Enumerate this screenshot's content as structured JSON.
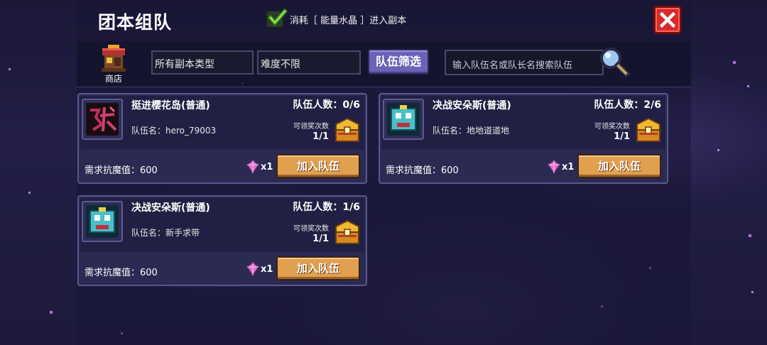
{
  "header": {
    "title": "团本组队",
    "consume_checked": true,
    "consume_label": "消耗［ 能量水晶 ］进入副本"
  },
  "toolbar": {
    "shop_label": "商店",
    "dungeon_type": "所有副本类型",
    "difficulty": "难度不限",
    "filter_label": "队伍筛选",
    "search_placeholder": "输入队伍名或队长名搜索队伍"
  },
  "cards": [
    {
      "dungeon": "挺进樱花岛(普通)",
      "members": "队伍人数：0/6",
      "team_name": "队伍名：hero_79003",
      "reward_label": "可领奖次数",
      "reward_count": "1/1",
      "magic": "需求抗魔值：600",
      "cost": "x1",
      "join": "加入队伍",
      "icon": "sakura-boss-icon"
    },
    {
      "dungeon": "决战安朵斯(普通)",
      "members": "队伍人数：2/6",
      "team_name": "队伍名：地地道道地",
      "reward_label": "可领奖次数",
      "reward_count": "1/1",
      "magic": "需求抗魔值：600",
      "cost": "x1",
      "join": "加入队伍",
      "icon": "andus-boss-icon"
    },
    {
      "dungeon": "决战安朵斯(普通)",
      "members": "队伍人数：1/6",
      "team_name": "队伍名：新手求带",
      "reward_label": "可领奖次数",
      "reward_count": "1/1",
      "magic": "需求抗魔值：600",
      "cost": "x1",
      "join": "加入队伍",
      "icon": "andus-boss-icon"
    }
  ],
  "colors": {
    "close": "#d82a2a",
    "join": "#e0a050",
    "filter": "#6a63b8"
  }
}
